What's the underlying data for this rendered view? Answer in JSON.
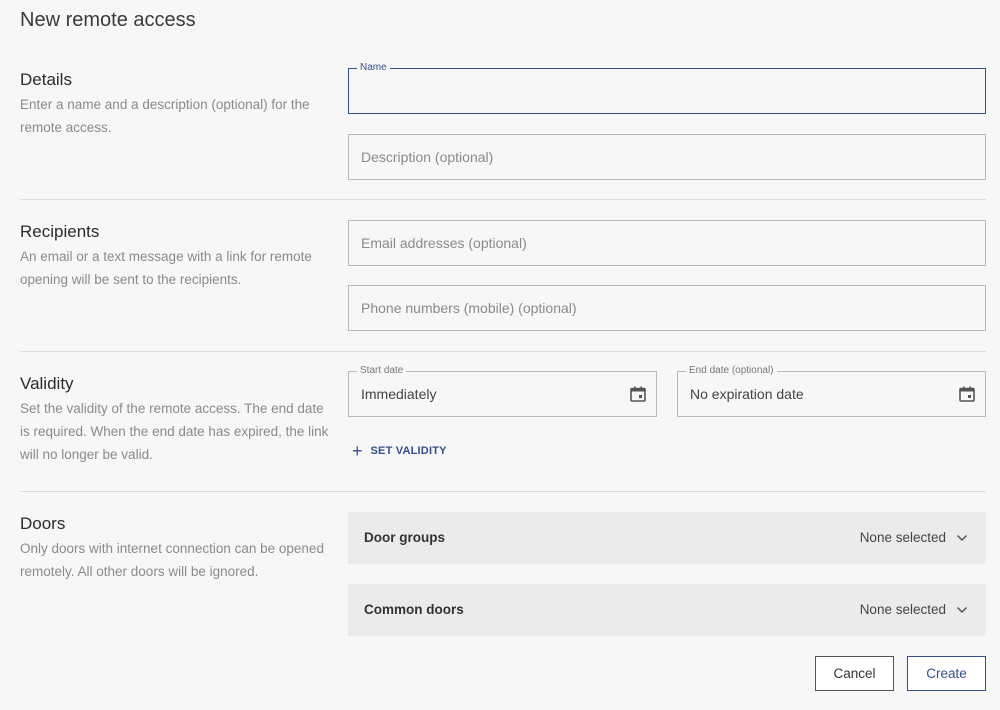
{
  "page": {
    "title": "New remote access"
  },
  "details": {
    "title": "Details",
    "description": "Enter a name and a description (optional) for the remote access.",
    "name_label": "Name",
    "name_value": "",
    "description_placeholder": "Description (optional)"
  },
  "recipients": {
    "title": "Recipients",
    "description": "An email or a text message with a link for remote opening will be sent to the recipients.",
    "email_placeholder": "Email addresses (optional)",
    "phone_placeholder": "Phone numbers (mobile) (optional)"
  },
  "validity": {
    "title": "Validity",
    "description": "Set the validity of the remote access. The end date is required. When the end date has expired, the link will no longer be valid.",
    "start_label": "Start date",
    "start_value": "Immediately",
    "end_label": "End date (optional)",
    "end_value": "No expiration date",
    "set_validity_label": "SET VALIDITY"
  },
  "doors": {
    "title": "Doors",
    "description": "Only doors with internet connection can be opened remotely. All other doors will be ignored.",
    "rows": [
      {
        "label": "Door groups",
        "value": "None selected"
      },
      {
        "label": "Common doors",
        "value": "None selected"
      }
    ]
  },
  "actions": {
    "cancel_label": "Cancel",
    "create_label": "Create"
  },
  "icons": {
    "calendar": "calendar-icon",
    "chevron": "chevron-down-icon",
    "plus": "plus-icon"
  },
  "colors": {
    "accent": "#34508a",
    "background": "#f7f7f7",
    "row_bg": "#ebebeb"
  }
}
